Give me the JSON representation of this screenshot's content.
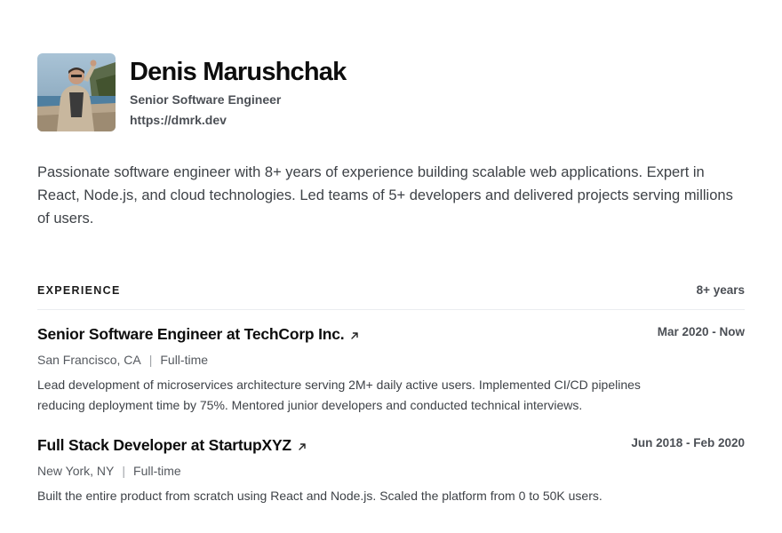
{
  "profile": {
    "name": "Denis Marushchak",
    "title": "Senior Software Engineer",
    "website": "https://dmrk.dev",
    "summary": "Passionate software engineer with 8+ years of experience building scalable web applications. Expert in React, Node.js, and cloud technologies. Led teams of 5+ developers and delivered projects serving millions of users."
  },
  "experience": {
    "heading": "EXPERIENCE",
    "total": "8+ years",
    "jobs": [
      {
        "title": "Senior Software Engineer at TechCorp Inc.",
        "location": "San Francisco, CA",
        "separator": "|",
        "type": "Full-time",
        "dates": "Mar 2020 - Now",
        "description": "Lead development of microservices architecture serving 2M+ daily active users. Implemented CI/CD pipelines reducing deployment time by 75%. Mentored junior developers and conducted technical interviews."
      },
      {
        "title": "Full Stack Developer at StartupXYZ",
        "location": "New York, NY",
        "separator": "|",
        "type": "Full-time",
        "dates": "Jun 2018 - Feb 2020",
        "description": "Built the entire product from scratch using React and Node.js. Scaled the platform from 0 to 50K users."
      }
    ]
  },
  "icons": {
    "external_link": "external-link-icon",
    "avatar": "profile-photo"
  }
}
